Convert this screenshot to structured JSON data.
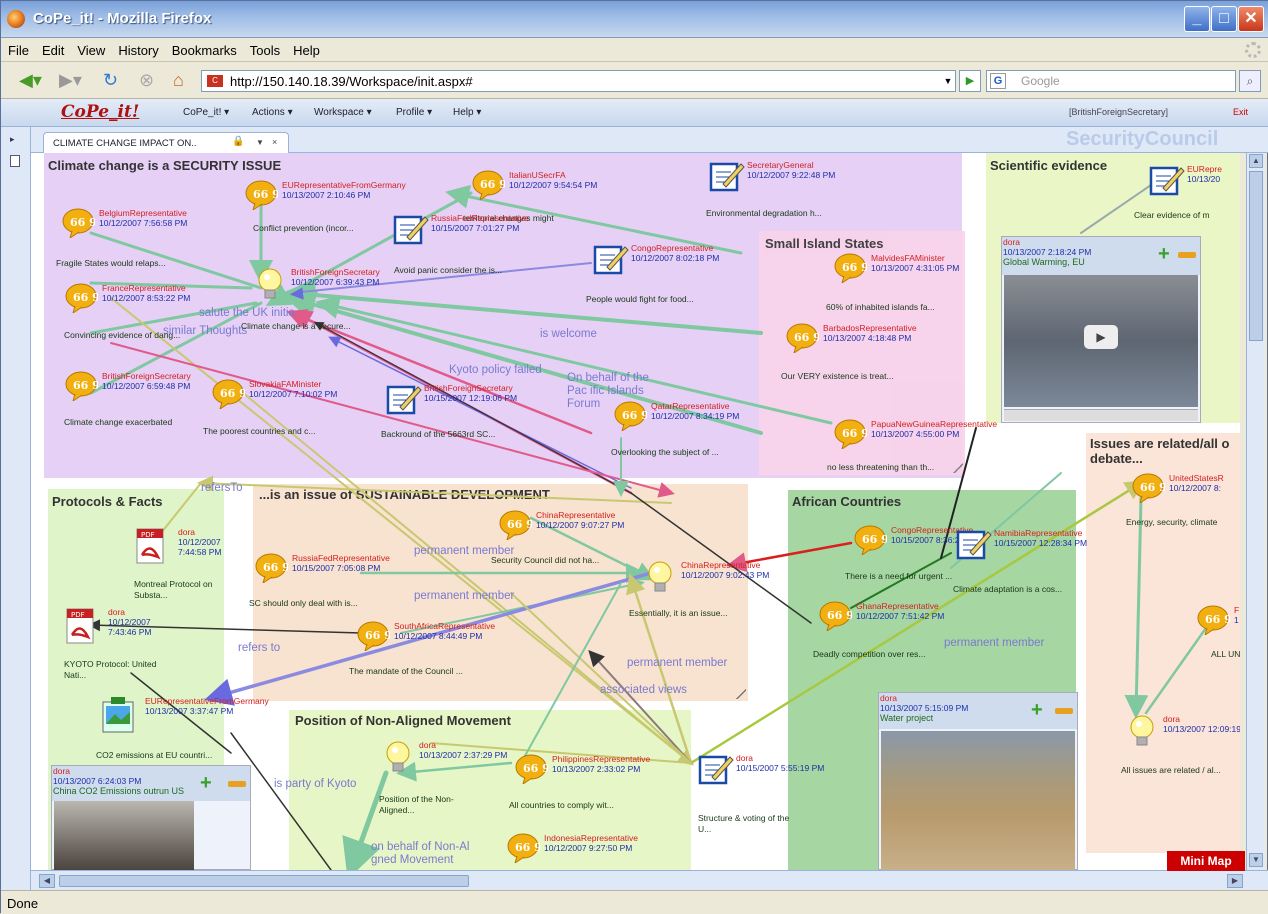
{
  "browser": {
    "title": "CoPe_it! - Mozilla Firefox",
    "menu": [
      "File",
      "Edit",
      "View",
      "History",
      "Bookmarks",
      "Tools",
      "Help"
    ],
    "url": "http://150.140.18.39/Workspace/init.aspx#",
    "search_placeholder": "Google",
    "status": "Done"
  },
  "app": {
    "logo": "CoPe_it!",
    "menu": [
      "CoPe_it! ▾",
      "Actions ▾",
      "Workspace ▾",
      "Profile ▾",
      "Help ▾"
    ],
    "user": "[BritishForeignSecretary]",
    "exit": "Exit",
    "tab": "CLIMATE CHANGE IMPACT ON..",
    "workspace": "SecurityCouncil",
    "minimap": "Mini Map"
  },
  "regions": [
    {
      "title": "Climate change is a SECURITY ISSUE",
      "color": "#e6d0f6"
    },
    {
      "title": "Small Island States",
      "color": "#f8d4ea"
    },
    {
      "title": "Scientific evidence",
      "color": "#eaf6c6"
    },
    {
      "title": "Protocols & Facts",
      "color": "#dff4c8"
    },
    {
      "title": "...is an issue of SUSTAINABLE DEVELOPMENT",
      "color": "#f8e2d0"
    },
    {
      "title": "African Countries",
      "color": "#a6d6a2"
    },
    {
      "title": "Issues are related/all o debate...",
      "color": "#fbe4d8"
    },
    {
      "title": "Position of Non-Aligned Movement",
      "color": "#e6f6c6"
    }
  ],
  "nodes": [
    {
      "type": "comment",
      "author": "EURepresentativeFromGermany",
      "date": "10/13/2007 2:10:46 PM",
      "summary": "Conflict prevention (incor..."
    },
    {
      "type": "comment",
      "author": "ItalianUSecrFA",
      "date": "10/12/2007 9:54:54 PM",
      "summary": "territorial changes might"
    },
    {
      "type": "note",
      "author": "SecretaryGeneral",
      "date": "10/12/2007 9:22:48 PM",
      "summary": "Environmental degradation h..."
    },
    {
      "type": "comment",
      "author": "BelgiumRepresentative",
      "date": "10/12/2007 7:56:58 PM",
      "summary": "Fragile States would relaps..."
    },
    {
      "type": "note",
      "author": "RussiaFedRepresentative",
      "date": "10/15/2007 7:01:27 PM",
      "summary": "Avoid panic consider the is..."
    },
    {
      "type": "note",
      "author": "CongoRepresentative",
      "date": "10/12/2007 8:02:18 PM",
      "summary": "People would fight for food..."
    },
    {
      "type": "idea",
      "author": "BritishForeignSecretary",
      "date": "10/12/2007 6:39:43 PM",
      "summary": "Climate change is a secure..."
    },
    {
      "type": "comment",
      "author": "FranceRepresentative",
      "date": "10/12/2007 8:53:22 PM",
      "summary": "Convincing evidence of dang..."
    },
    {
      "type": "comment",
      "author": "MalvidesFAMinister",
      "date": "10/13/2007 4:31:05 PM",
      "summary": "60% of inhabited islands fa..."
    },
    {
      "type": "comment",
      "author": "BarbadosRepresentative",
      "date": "10/13/2007 4:18:48 PM",
      "summary": "Our VERY existence is treat..."
    },
    {
      "type": "comment",
      "author": "BritishForeignSecretary",
      "date": "10/12/2007 6:59:48 PM",
      "summary": "Climate change exacerbated"
    },
    {
      "type": "comment",
      "author": "SlovakiaFAMinister",
      "date": "10/12/2007 7:10:02 PM",
      "summary": "The poorest countries and c..."
    },
    {
      "type": "note",
      "author": "BritishForeignSecretary",
      "date": "10/15/2007 12:19:06 PM",
      "summary": "Backround of the 5663rd SC..."
    },
    {
      "type": "comment",
      "author": "QatarRepresentative",
      "date": "10/12/2007 8:34:19 PM",
      "summary": "Overlooking the subject of ..."
    },
    {
      "type": "comment",
      "author": "PapuaNewGuineaRepresentative",
      "date": "10/13/2007 4:55:00 PM",
      "summary": "no less threatening than th..."
    },
    {
      "type": "note",
      "author": "EURepre",
      "date": "10/13/20",
      "summary": "Clear evidence of m"
    },
    {
      "type": "pdf",
      "author": "dora",
      "date": "10/12/2007 7:44:58 PM",
      "summary": "Montreal Protocol on Substa..."
    },
    {
      "type": "pdf",
      "author": "dora",
      "date": "10/12/2007 7:43:46 PM",
      "summary": "KYOTO Protocol: United Nati..."
    },
    {
      "type": "img",
      "author": "EURepresentativeFromGermany",
      "date": "10/13/2007 3:37:47 PM",
      "summary": "CO2 emissions at EU countri..."
    },
    {
      "type": "comment",
      "author": "ChinaRepresentative",
      "date": "10/12/2007 9:07:27 PM",
      "summary": "Security Council did not ha..."
    },
    {
      "type": "comment",
      "author": "RussiaFedRepresentative",
      "date": "10/15/2007 7:05:08 PM",
      "summary": "SC should only deal with is..."
    },
    {
      "type": "idea",
      "author": "ChinaRepresentative",
      "date": "10/12/2007 9:02:43 PM",
      "summary": "Essentially, it is an issue..."
    },
    {
      "type": "comment",
      "author": "SouthAfricaRepresentative",
      "date": "10/12/2007 8:44:49 PM",
      "summary": "The mandate of the Council ..."
    },
    {
      "type": "comment",
      "author": "CongoRepresentative",
      "date": "10/15/2007 8:36:23 PM",
      "summary": "There is a need for urgent ..."
    },
    {
      "type": "note",
      "author": "NamibiaRepresentative",
      "date": "10/15/2007 12:28:34 PM",
      "summary": "Climate adaptation is a cos..."
    },
    {
      "type": "comment",
      "author": "GhanaRepresentative",
      "date": "10/12/2007 7:51:42 PM",
      "summary": "Deadly competition over res..."
    },
    {
      "type": "comment",
      "author": "UnitedStatesR",
      "date": "10/12/2007 8:",
      "summary": "Energy, security, climate"
    },
    {
      "type": "comment",
      "author": "F",
      "date": "1 F",
      "summary": "ALL UN orga"
    },
    {
      "type": "idea",
      "author": "dora",
      "date": "10/13/2007 12:09:19 PM",
      "summary": "All issues are related / al..."
    },
    {
      "type": "idea",
      "author": "dora",
      "date": "10/13/2007 2:37:29 PM",
      "summary": "Position of the Non-Aligned..."
    },
    {
      "type": "comment",
      "author": "PhilippinesRepresentative",
      "date": "10/13/2007 2:33:02 PM",
      "summary": "All countries to comply wit..."
    },
    {
      "type": "comment",
      "author": "IndonesiaRepresentative",
      "date": "10/12/2007 9:27:50 PM",
      "summary": ""
    },
    {
      "type": "note",
      "author": "dora",
      "date": "10/15/2007 5:55:19 PM",
      "summary": "Structure & voting of the U..."
    }
  ],
  "media": [
    {
      "author": "dora",
      "date": "10/13/2007 2:18:24 PM",
      "title": "Global Warming, EU"
    },
    {
      "author": "dora",
      "date": "10/13/2007 6:24:03 PM",
      "title": "China CO2 Emissions outrun US"
    },
    {
      "author": "dora",
      "date": "10/13/2007 5:15:09 PM",
      "title": "Water project"
    }
  ],
  "edge_labels": [
    "salute the UK initia",
    "similar Thoughts",
    "is welcome",
    "Kyoto policy failed",
    "On behalf of the Pac ific Islands Forum",
    "refersTo",
    "permanent member",
    "permanent member",
    "refers to",
    "permanent member",
    "associated views",
    "permanent member",
    "is party of Kyoto",
    "on behalf of Non-Al gned Movement"
  ]
}
